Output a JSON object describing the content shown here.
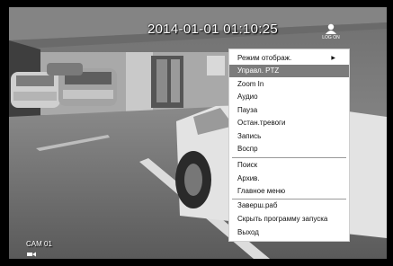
{
  "overlay": {
    "datetime": "2014-01-01 01:10:25",
    "logon_label": "LOG ON",
    "camera_name": "CAM 01",
    "camera_icon": "camera-recording-icon"
  },
  "context_menu": {
    "items": [
      {
        "label": "Режим отображ.",
        "submenu": true
      },
      {
        "label": "Управл. PTZ",
        "selected": true
      },
      {
        "label": "Zoom In"
      },
      {
        "label": "Аудио"
      },
      {
        "label": "Пауза"
      },
      {
        "label": "Остан.тревоги"
      },
      {
        "label": "Запись"
      },
      {
        "label": "Воспр"
      },
      {
        "label": "Поиск"
      },
      {
        "label": "Архив."
      },
      {
        "label": "Главное меню"
      },
      {
        "label": "Заверш.раб"
      },
      {
        "label": "Скрыть программу запуска"
      },
      {
        "label": "Выход"
      }
    ],
    "submenu_arrow": "▶"
  },
  "colors": {
    "menu_bg": "#ffffff",
    "selected_bg": "#7c7c7c",
    "separator": "#999999"
  }
}
